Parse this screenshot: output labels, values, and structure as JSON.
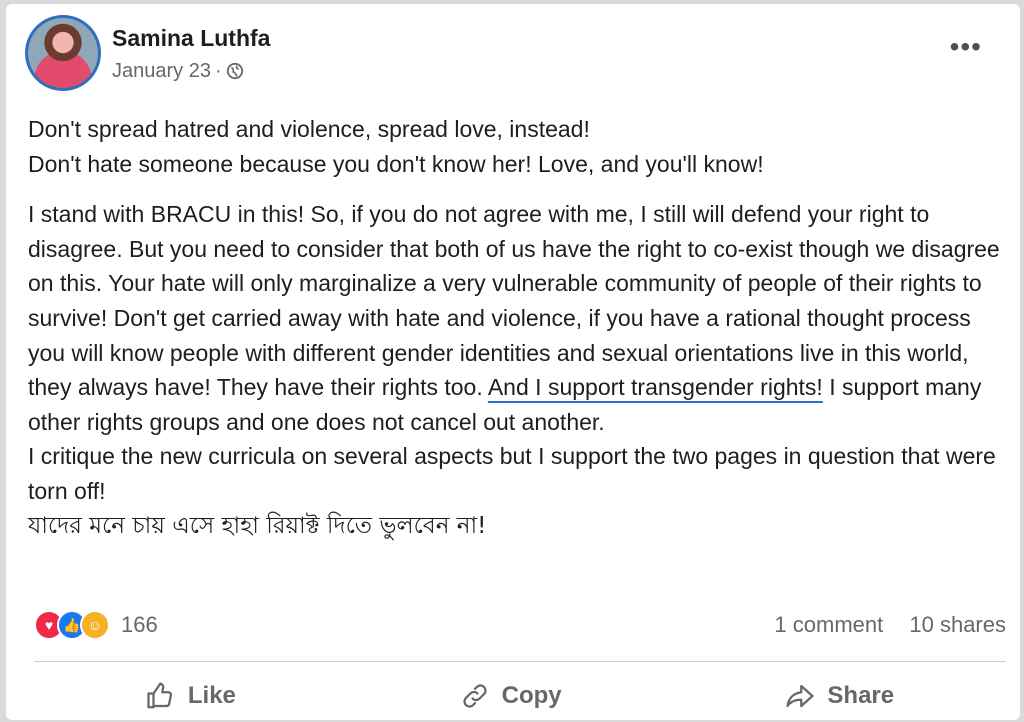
{
  "post": {
    "author": "Samina Luthfa",
    "date": "January 23",
    "separator": "·",
    "icons": {
      "privacy": "globe-icon",
      "more": "more-options-icon"
    },
    "paragraphs": [
      "Don't spread hatred and violence, spread love, instead!",
      "Don't hate someone because you don't know her! Love, and you'll know!"
    ],
    "body_before_underline": "I stand with BRACU in this! So, if you do not agree with me, I still will defend your right to disagree. But you need to consider that both of us have the right to co-exist though we disagree on this. Your hate will only marginalize a very vulnerable community of people of their rights to survive! Don't get carried away with hate and violence, if you have a rational thought process you will know people with different gender identities and sexual orientations live in this world, they always have! They have their rights too. ",
    "underlined_text": "And I support transgender rights!",
    "body_after_underline": " I support many other rights groups and one does not cancel out another.",
    "critique": "I critique the new curricula on several aspects but I support the two pages in question that were torn off!",
    "bangla_line": "যাদের মনে চায় এসে হাহা রিয়াক্ট দিতে ভুলবেন না!"
  },
  "stats": {
    "reaction_icons": [
      "love-reaction-icon",
      "like-reaction-icon",
      "care-reaction-icon"
    ],
    "reaction_count": "166",
    "comments": "1 comment",
    "shares": "10 shares"
  },
  "actions": {
    "like": "Like",
    "copy": "Copy",
    "share": "Share"
  },
  "colors": {
    "underline": "#2a6ccf",
    "love": "#f0284a",
    "like": "#1877f2",
    "care": "#f7b125"
  }
}
